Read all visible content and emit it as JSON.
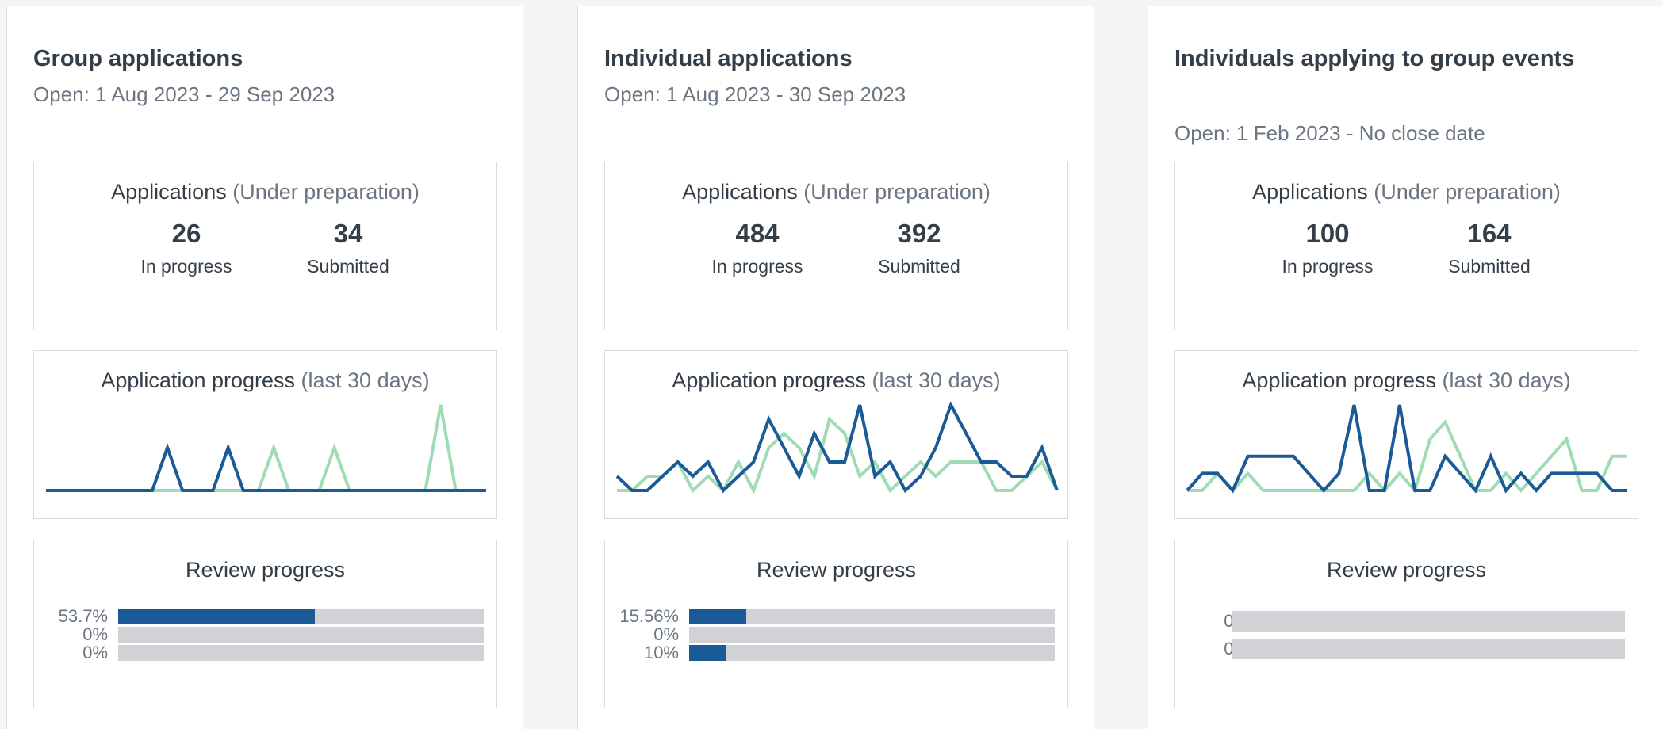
{
  "colors": {
    "in_progress": "#1a5a96",
    "submitted": "#9fdcb4",
    "track": "#d0d2d5",
    "fill": "#1a5a96"
  },
  "cards": [
    {
      "title": "Group applications",
      "dates": "Open: 1 Aug 2023 - 29 Sep 2023",
      "applications": {
        "heading": "Applications",
        "heading_note": "(Under preparation)",
        "in_progress_value": "26",
        "in_progress_label": "In progress",
        "submitted_value": "34",
        "submitted_label": "Submitted"
      },
      "progress": {
        "heading": "Application progress",
        "heading_note": "(last 30 days)",
        "chart_data": {
          "type": "line",
          "x": [
            1,
            2,
            3,
            4,
            5,
            6,
            7,
            8,
            9,
            10,
            11,
            12,
            13,
            14,
            15,
            16,
            17,
            18,
            19,
            20,
            21,
            22,
            23,
            24,
            25,
            26,
            27,
            28,
            29,
            30
          ],
          "series": [
            {
              "values": [
                0,
                0,
                0,
                0,
                0,
                0,
                0,
                0,
                1,
                0,
                0,
                0,
                1,
                0,
                0,
                0,
                0,
                0,
                0,
                0,
                0,
                0,
                0,
                0,
                0,
                0,
                0,
                0,
                0,
                0
              ]
            },
            {
              "values": [
                0,
                0,
                0,
                0,
                0,
                0,
                0,
                0,
                0,
                0,
                0,
                0,
                0,
                0,
                0,
                1,
                0,
                0,
                0,
                1,
                0,
                0,
                0,
                0,
                0,
                0,
                2,
                0,
                0,
                0
              ]
            }
          ]
        }
      },
      "review": {
        "heading": "Review progress",
        "rows": [
          {
            "label": "53.7%",
            "value": 53.7
          },
          {
            "label": "0%",
            "value": 0
          },
          {
            "label": "0%",
            "value": 0
          }
        ]
      }
    },
    {
      "title": "Individual applications",
      "dates": "Open: 1 Aug 2023 - 30 Sep 2023",
      "applications": {
        "heading": "Applications",
        "heading_note": "(Under preparation)",
        "in_progress_value": "484",
        "in_progress_label": "In progress",
        "submitted_value": "392",
        "submitted_label": "Submitted"
      },
      "progress": {
        "heading": "Application progress",
        "heading_note": "(last 30 days)",
        "chart_data": {
          "type": "line",
          "x": [
            1,
            2,
            3,
            4,
            5,
            6,
            7,
            8,
            9,
            10,
            11,
            12,
            13,
            14,
            15,
            16,
            17,
            18,
            19,
            20,
            21,
            22,
            23,
            24,
            25,
            26,
            27,
            28,
            29,
            30,
            31
          ],
          "series": [
            {
              "values": [
                1,
                0,
                0,
                1,
                2,
                1,
                2,
                0,
                1,
                2,
                5,
                3,
                1,
                4,
                2,
                2,
                6,
                1,
                2,
                0,
                1,
                3,
                6,
                4,
                2,
                2,
                1,
                1,
                3,
                0
              ]
            },
            {
              "values": [
                0,
                0,
                1,
                1,
                2,
                0,
                1,
                0,
                2,
                0,
                3,
                4,
                3,
                1,
                5,
                4,
                1,
                2,
                0,
                1,
                2,
                1,
                2,
                2,
                2,
                0,
                0,
                1,
                2,
                0
              ]
            }
          ]
        }
      },
      "review": {
        "heading": "Review progress",
        "rows": [
          {
            "label": "15.56%",
            "value": 15.56
          },
          {
            "label": "0%",
            "value": 0
          },
          {
            "label": "10%",
            "value": 10
          }
        ]
      }
    },
    {
      "title": "Individuals applying to group events",
      "dates": "Open: 1 Feb 2023 - No close date",
      "applications": {
        "heading": "Applications",
        "heading_note": "(Under preparation)",
        "in_progress_value": "100",
        "in_progress_label": "In progress",
        "submitted_value": "164",
        "submitted_label": "Submitted"
      },
      "progress": {
        "heading": "Application progress",
        "heading_note": "(last 30 days)",
        "chart_data": {
          "type": "line",
          "x": [
            1,
            2,
            3,
            4,
            5,
            6,
            7,
            8,
            9,
            10,
            11,
            12,
            13,
            14,
            15,
            16,
            17,
            18,
            19,
            20,
            21,
            22,
            23,
            24,
            25,
            26,
            27,
            28,
            29,
            30
          ],
          "series": [
            {
              "values": [
                0,
                1,
                1,
                0,
                2,
                2,
                2,
                2,
                1,
                0,
                1,
                5,
                0,
                0,
                5,
                0,
                0,
                2,
                1,
                0,
                2,
                0,
                1,
                0,
                1,
                1,
                1,
                1,
                0,
                0
              ]
            },
            {
              "values": [
                0,
                0,
                1,
                0,
                1,
                0,
                0,
                0,
                0,
                0,
                0,
                0,
                1,
                0,
                1,
                0,
                3,
                4,
                2,
                0,
                0,
                1,
                0,
                1,
                2,
                3,
                0,
                0,
                2,
                2
              ]
            }
          ]
        }
      },
      "review": {
        "heading": "Review progress",
        "rows": [
          {
            "label": "0%",
            "value": 0
          },
          {
            "label": "0%",
            "value": 0
          }
        ]
      }
    }
  ]
}
